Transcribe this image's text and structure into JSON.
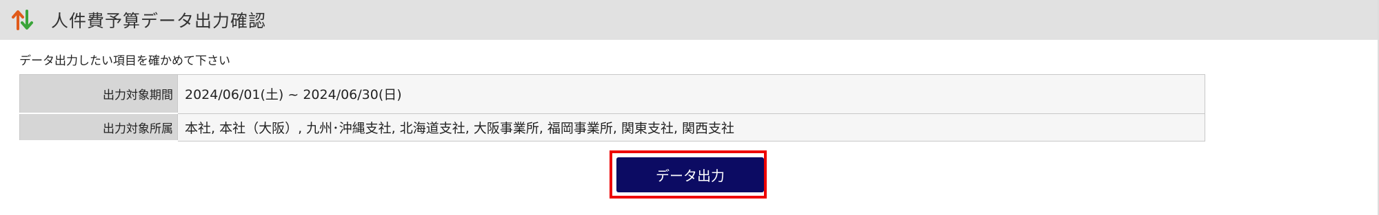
{
  "header": {
    "icon": "sort-arrows-icon",
    "title": "人件費予算データ出力確認",
    "icon_colors": {
      "up_arrow": "#e05a1a",
      "down_arrow": "#3aa53a"
    }
  },
  "instruction": "データ出力したい項目を確かめて下さい",
  "details": {
    "period_label": "出力対象期間",
    "period_value": "2024/06/01(土) ~ 2024/06/30(日)",
    "departments_label": "出力対象所属",
    "departments_value": "本社, 本社（大阪）, 九州･沖縄支社, 北海道支社, 大阪事業所, 福岡事業所, 関東支社, 関西支社"
  },
  "actions": {
    "output_button_label": "データ出力",
    "button_color": "#0c0b63",
    "highlight_color": "#ee0000"
  }
}
